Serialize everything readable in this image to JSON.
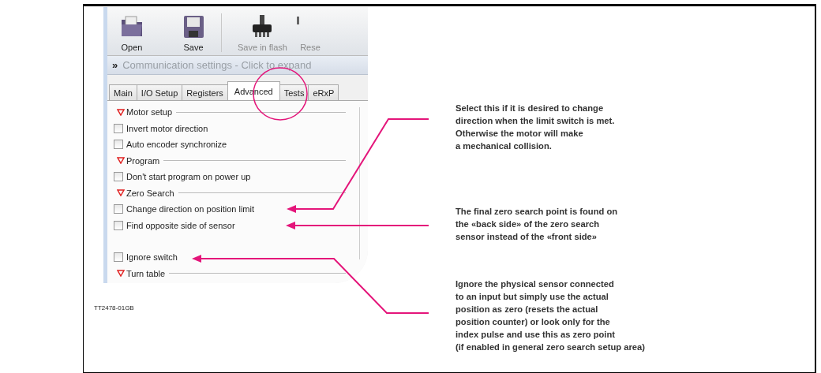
{
  "toolbar": {
    "buttons": [
      {
        "label": "Open",
        "kind": "open",
        "disabled": false
      },
      {
        "label": "Save",
        "kind": "save",
        "disabled": false
      },
      {
        "label": "Save in flash",
        "kind": "flash",
        "disabled": true
      },
      {
        "label": "Rese",
        "kind": "cut",
        "disabled": true
      }
    ]
  },
  "comm_bar": {
    "glyph": "»",
    "label": "Communication settings - Click to expand"
  },
  "tabs": [
    {
      "label": "Main",
      "selected": false
    },
    {
      "label": "I/O Setup",
      "selected": false
    },
    {
      "label": "Registers",
      "selected": false
    },
    {
      "label": "Advanced",
      "selected": true
    },
    {
      "label": "Tests",
      "selected": false
    },
    {
      "label": "eRxP",
      "selected": false
    }
  ],
  "panel": {
    "items": [
      {
        "kind": "section",
        "label": "Motor setup",
        "expanded": true
      },
      {
        "kind": "checkbox",
        "label": "Invert motor direction",
        "checked": false
      },
      {
        "kind": "checkbox",
        "label": "Auto encoder synchronize",
        "checked": false
      },
      {
        "kind": "section",
        "label": "Program",
        "expanded": true
      },
      {
        "kind": "checkbox",
        "label": "Don't start program on power up",
        "checked": false
      },
      {
        "kind": "section",
        "label": "Zero Search",
        "expanded": true
      },
      {
        "kind": "checkbox",
        "label": "Change direction on position limit",
        "checked": false
      },
      {
        "kind": "checkbox",
        "label": "Find opposite side of sensor",
        "checked": false
      },
      {
        "kind": "spacer"
      },
      {
        "kind": "checkbox",
        "label": "Ignore switch",
        "checked": false
      },
      {
        "kind": "section",
        "label": "Turn table",
        "expanded": true
      }
    ]
  },
  "figure_code": "TT2478-01GB",
  "annotations": [
    {
      "lines": [
        "Select this if it is desired to change",
        "direction when the limit switch is met.",
        "Otherwise the motor will make",
        "a mechanical collision."
      ]
    },
    {
      "lines": [
        "The final zero search point is found on",
        "the «back side» of the zero search",
        "sensor instead of the «front side»"
      ]
    },
    {
      "lines": [
        "Ignore the physical sensor connected",
        "to an input but simply use the actual",
        "position as zero (resets the actual",
        "position counter) or look only for the",
        "index pulse and use this as zero point",
        "(if enabled in general zero search setup area)"
      ]
    }
  ]
}
